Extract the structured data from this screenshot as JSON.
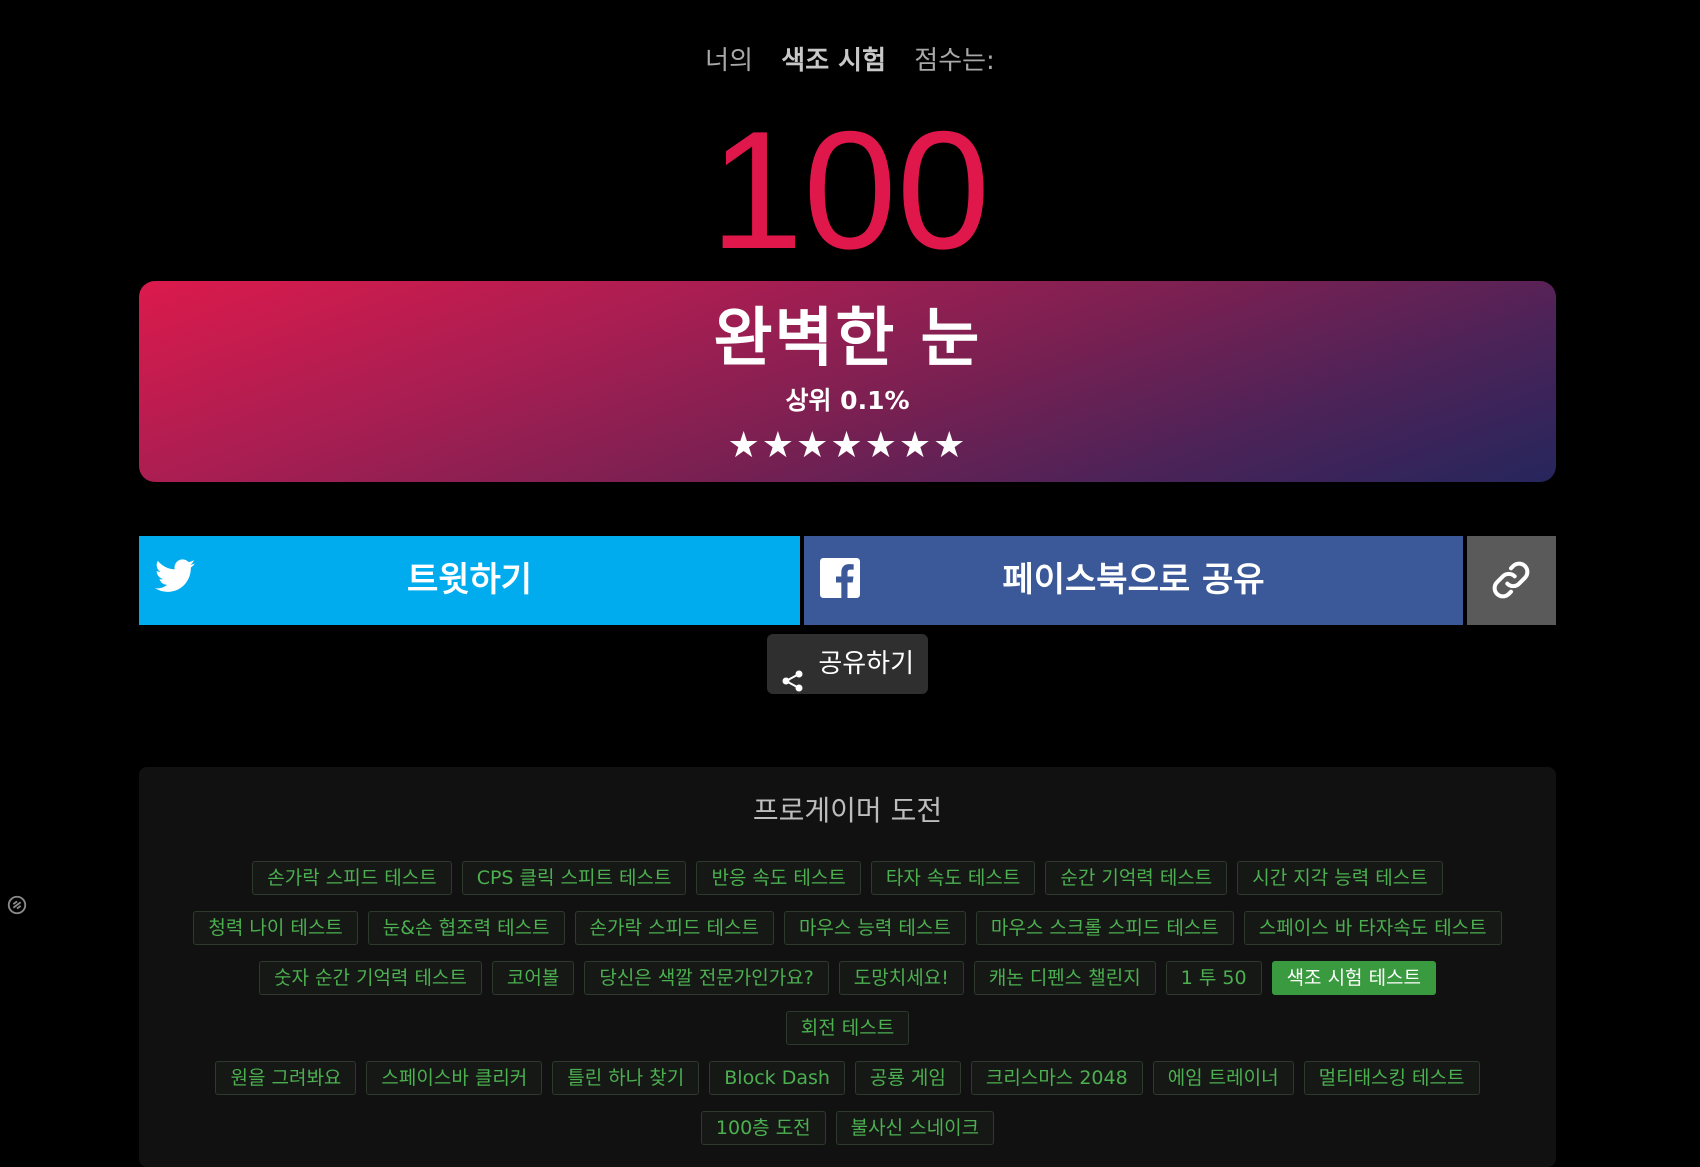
{
  "header": {
    "prefix": "너의",
    "test_name": "색조 시험",
    "suffix": "점수는:"
  },
  "score": "100",
  "result": {
    "title": "완벽한 눈",
    "rank": "상위 0.1%",
    "stars": "★★★★★★★"
  },
  "share": {
    "twitter_label": "트윗하기",
    "facebook_label": "페이스북으로 공유",
    "share_label": "공유하기"
  },
  "pro_challenge": {
    "title": "프로게이머 도전",
    "tags": [
      "손가락 스피드 테스트",
      "CPS 클릭 스피트 테스트",
      "반응 속도 테스트",
      "타자 속도 테스트",
      "순간 기억력 테스트",
      "시간 지각 능력 테스트",
      "청력 나이 테스트",
      "눈&손 협조력 테스트",
      "손가락 스피드 테스트",
      "마우스 능력 테스트",
      "마우스 스크롤 스피드 테스트",
      "스페이스 바 타자속도 테스트",
      "숫자 순간 기억력 테스트",
      "코어볼",
      "당신은 색깔 전문가인가요?",
      "도망치세요!",
      "캐논 디펜스 챌린지",
      "1 투 50",
      "색조 시험 테스트",
      "회전 테스트",
      "원을 그려봐요",
      "스페이스바 클리커",
      "틀린 하나 찾기",
      "Block Dash",
      "공룡 게임",
      "크리스마스 2048",
      "에임 트레이너",
      "멀티태스킹 테스트",
      "100층 도전",
      "불사신 스네이크"
    ],
    "active_tag": "색조 시험 테스트"
  },
  "colors": {
    "score": "#e0174b",
    "twitter": "#00acee",
    "facebook": "#3b5998",
    "tag_text": "#4caf50",
    "tag_active": "#3a9a3f"
  }
}
